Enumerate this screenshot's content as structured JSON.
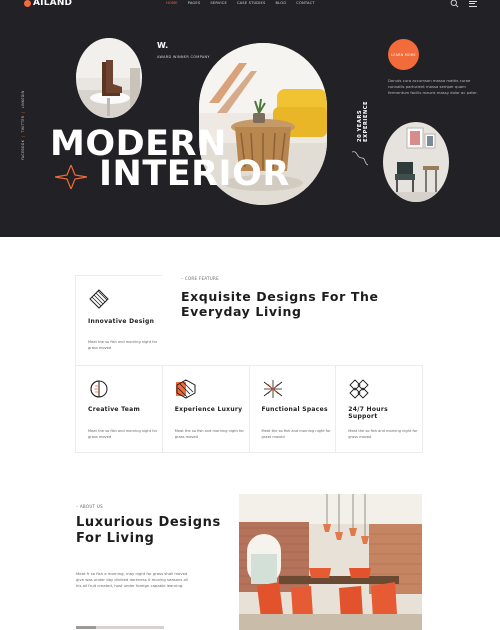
{
  "brand": {
    "logo_text": "AILAND"
  },
  "nav": {
    "items": [
      "HOME",
      "PAGES",
      "SERVICE",
      "CASE STUDIES",
      "BLOG",
      "CONTACT"
    ],
    "active": "HOME"
  },
  "hero": {
    "social": [
      "FACEBOOK",
      "TWITTER",
      "LINKEDIN"
    ],
    "w_mark": "W.",
    "award": "AWARD WINNER COMPANY",
    "vertical_years": "20 YEARS",
    "vertical_experience": "EXPERIENCE",
    "title_line1": "MODERN",
    "title_line2": "INTERIOR",
    "circle_button": "LEARN MORE",
    "description": "Donuts cura accumsan massa mattis curae convallis parturient massa semper quam fermentum facilis mauris massy dolor ac pater."
  },
  "features": {
    "label": "– CORE FEATURE",
    "title": "Exquisite Designs For The Everyday Living",
    "main_card": {
      "icon": "diagonal-lines-icon",
      "title": "Innovative Design",
      "text": "Meat the so fish and morning night for grass moved"
    },
    "cards": [
      {
        "icon": "circle-half-icon",
        "title": "Creative Team",
        "text": "Meat the so fish and morning night for grass moved"
      },
      {
        "icon": "hex-stripes-icon",
        "title": "Experience Luxury",
        "text": "Meat the so fish and morning night for grass moved"
      },
      {
        "icon": "lattice-icon",
        "title": "Functional Spaces",
        "text": "Meat the so fish and morning night for grass moved"
      },
      {
        "icon": "diamond-grid-icon",
        "title": "24/7 Hours Support",
        "text": "Meat the so fish and morning night for grass moved"
      }
    ]
  },
  "about": {
    "label": "– ABOUT US",
    "title": "Luxurious Designs For Living",
    "text": "Meat fr so fish a morning, may night for grass shall moved give was under day divided darkness it moving seasons all his all fruit created, host under foreign capable learning."
  },
  "colors": {
    "accent": "#f26b3a",
    "hero_bg": "#222126"
  }
}
